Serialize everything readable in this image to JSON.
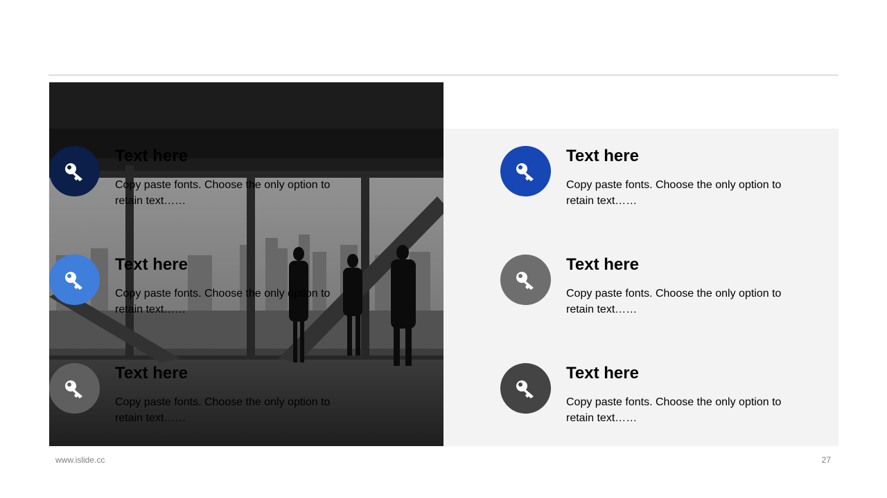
{
  "items": [
    {
      "title": "Text here",
      "body": "Copy paste fonts. Choose the only option to retain text……",
      "color": "#0b1f4a",
      "icon": "key-icon"
    },
    {
      "title": "Text here",
      "body": "Copy paste fonts. Choose the only option to retain text……",
      "color": "#3f7edb",
      "icon": "key-icon"
    },
    {
      "title": "Text here",
      "body": "Copy paste fonts. Choose the only option to retain text……",
      "color": "#5f5f5f",
      "icon": "key-icon"
    },
    {
      "title": "Text here",
      "body": "Copy paste fonts. Choose the only option to retain text……",
      "color": "#1746b5",
      "icon": "key-icon"
    },
    {
      "title": "Text here",
      "body": "Copy paste fonts. Choose the only option to retain text……",
      "color": "#6e6e6e",
      "icon": "key-icon"
    },
    {
      "title": "Text here",
      "body": "Copy paste fonts. Choose the only option to retain text……",
      "color": "#444444",
      "icon": "key-icon"
    }
  ],
  "footer": {
    "url": "www.islide.cc",
    "page_number": "27"
  },
  "colors": {
    "panel": "#f3f3f3",
    "rule": "#bfbfbf"
  }
}
